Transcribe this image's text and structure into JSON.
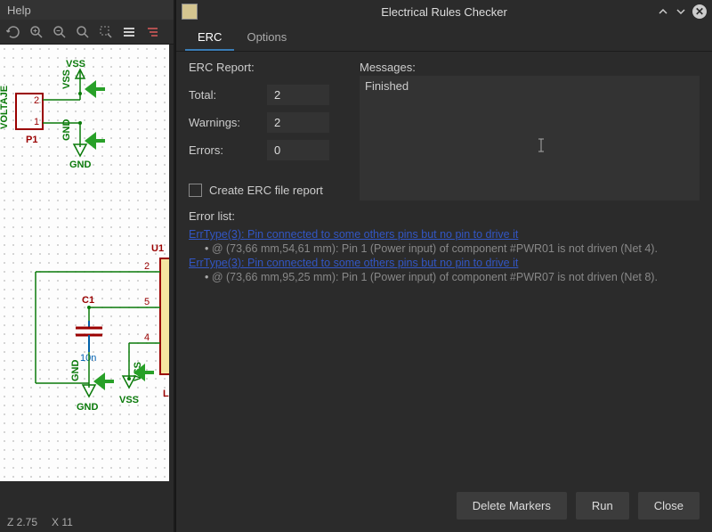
{
  "menu": {
    "help": "Help"
  },
  "status": {
    "zoom": "Z 2.75",
    "x": "X 11"
  },
  "schematic": {
    "vss_top": "VSS",
    "voltaje": "VOLTAJE",
    "p1": "P1",
    "gnd": "GND",
    "u1": "U1",
    "c1": "C1",
    "c1_val": "10n",
    "lm": "LM",
    "vss_bot": "VSS",
    "pins": {
      "p1_1": "1",
      "p1_2": "2",
      "u1_2": "2",
      "u1_5": "5",
      "u1_4": "4"
    }
  },
  "dialog": {
    "title": "Electrical Rules Checker",
    "tabs": {
      "erc": "ERC",
      "options": "Options"
    },
    "report": {
      "title": "ERC Report:",
      "total_label": "Total:",
      "total_val": "2",
      "warnings_label": "Warnings:",
      "warnings_val": "2",
      "errors_label": "Errors:",
      "errors_val": "0"
    },
    "create_report": "Create ERC file report",
    "messages": {
      "title": "Messages:",
      "body": "Finished"
    },
    "error_list_label": "Error list:",
    "errors": [
      {
        "link": "ErrType(3): Pin connected to some others pins but no pin to drive it",
        "detail": "@ (73,66 mm,54,61 mm): Pin 1 (Power input) of component #PWR01 is not driven (Net 4)."
      },
      {
        "link": "ErrType(3): Pin connected to some others pins but no pin to drive it",
        "detail": "@ (73,66 mm,95,25 mm): Pin 1 (Power input) of component #PWR07 is not driven (Net 8)."
      }
    ],
    "buttons": {
      "delete": "Delete Markers",
      "run": "Run",
      "close": "Close"
    }
  }
}
